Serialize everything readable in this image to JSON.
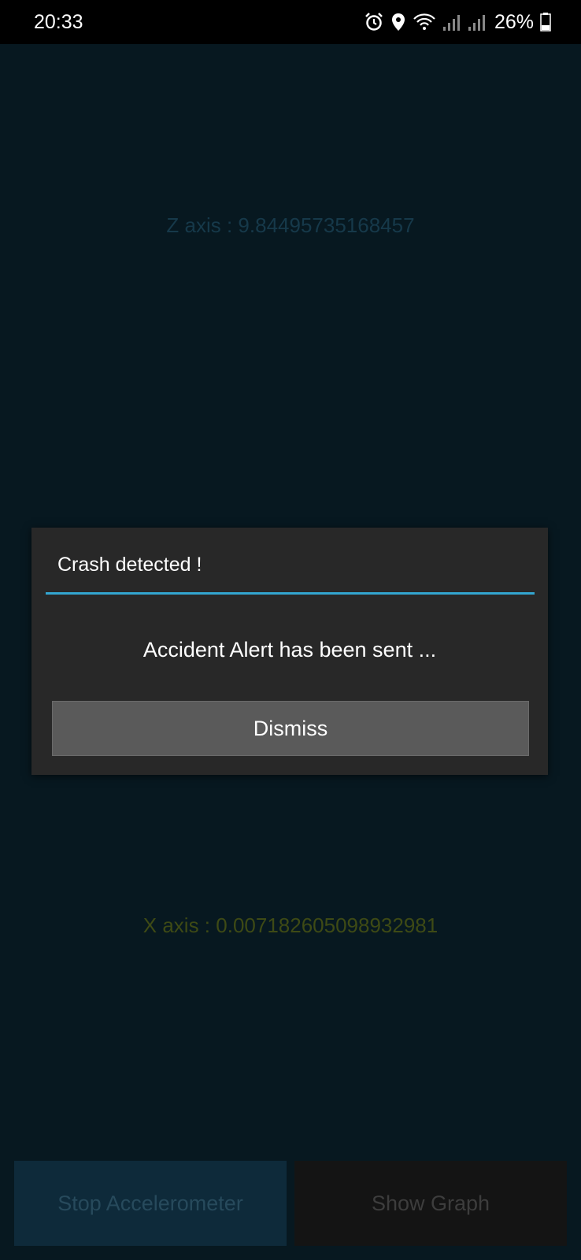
{
  "status_bar": {
    "time": "20:33",
    "icons": [
      "alarm-icon",
      "location-icon",
      "wifi-icon",
      "signal-icon",
      "signal-icon",
      "battery-icon"
    ],
    "battery_percent": "26%"
  },
  "app": {
    "z_axis_label": "Z axis : 9.84495735168457",
    "x_axis_label": "X axis : 0.007182605098932981",
    "stop_button_label": "Stop Accelerometer",
    "graph_button_label": "Show Graph"
  },
  "dialog": {
    "title": "Crash detected !",
    "message": "Accident Alert has been sent ...",
    "dismiss_label": "Dismiss"
  },
  "colors": {
    "accent": "#33a6d0",
    "dialog_background": "#282828",
    "app_background": "#071820"
  }
}
